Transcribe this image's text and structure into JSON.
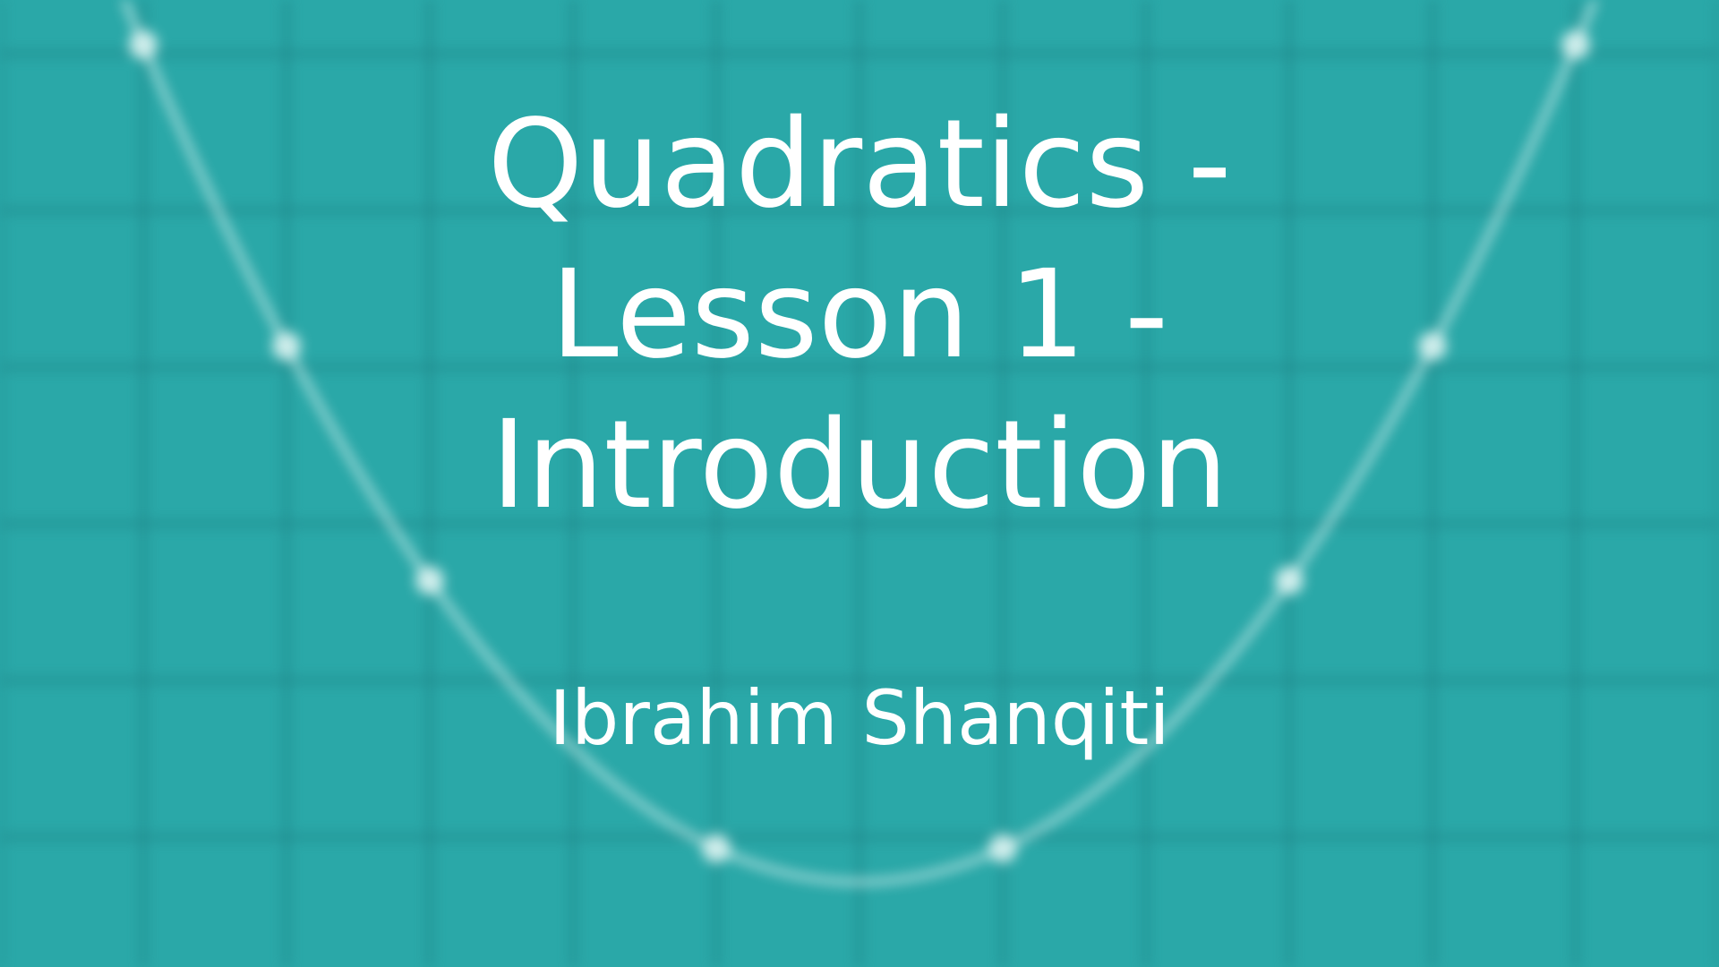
{
  "slide": {
    "title_lines": [
      "Quadratics -",
      "Lesson 1 -",
      "Introduction"
    ],
    "author": "Ibrahim Shanqiti"
  },
  "background": {
    "graph": {
      "x": [
        -5,
        -4,
        -3,
        -1,
        1,
        3,
        4,
        5
      ],
      "y": [
        25,
        16,
        9,
        1,
        1,
        9,
        16,
        25
      ]
    }
  },
  "colors": {
    "background": "#2aa8a8",
    "grid_line": "#1f8a8c",
    "curve": "#d9f2f0",
    "text": "#ffffff"
  }
}
